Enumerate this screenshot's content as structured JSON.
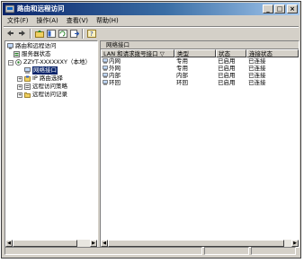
{
  "window": {
    "title": "路由和远程访问",
    "buttons": {
      "minimize": "_",
      "maximize": "□",
      "close": "×"
    }
  },
  "menubar": {
    "items": [
      "文件(F)",
      "操作(A)",
      "查看(V)",
      "帮助(H)"
    ]
  },
  "toolbar": {
    "icons": [
      "back-icon",
      "forward-icon",
      "up-icon",
      "show-tree-icon",
      "refresh-icon",
      "export-icon",
      "help-icon"
    ]
  },
  "tree": {
    "root": "路由和远程访问",
    "status": "服务器状态",
    "server": "ZZYT-XXXXXXY（本地）",
    "children": [
      "网络接口",
      "IP 路由选择",
      "远程访问策略",
      "远程访问记录"
    ]
  },
  "details": {
    "pane_title": "网络接口",
    "columns": [
      "LAN 和请求拨号接口 ▽",
      "类型",
      "状态",
      "连接状态"
    ],
    "rows": [
      {
        "name": "内网",
        "type": "专用",
        "status": "已启用",
        "connection": "已连接"
      },
      {
        "name": "外网",
        "type": "专用",
        "status": "已启用",
        "connection": "已连接"
      },
      {
        "name": "内部",
        "type": "内部",
        "status": "已启用",
        "connection": "已连接"
      },
      {
        "name": "环回",
        "type": "环回",
        "status": "已启用",
        "connection": "已连接"
      }
    ]
  },
  "colors": {
    "titlebar_start": "#0a246a",
    "titlebar_end": "#a6caf0",
    "face": "#d4d0c8",
    "selection": "#0a246a"
  }
}
